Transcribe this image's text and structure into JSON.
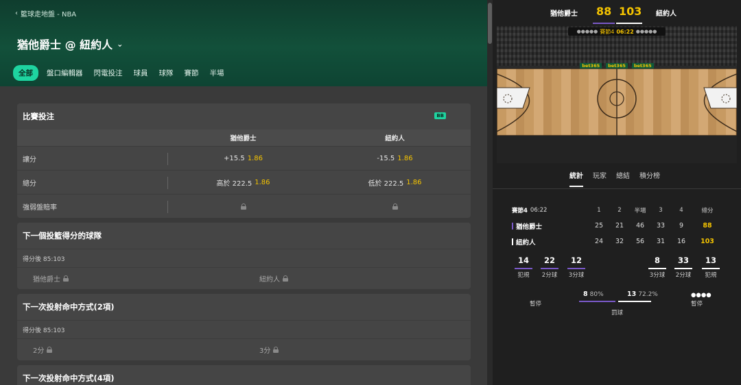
{
  "breadcrumb": {
    "back_icon": "chevron-left-icon",
    "text": "籃球走地盤 - NBA"
  },
  "match": {
    "title": "猶他爵士 @ 紐約人"
  },
  "tabs": [
    "全部",
    "盤口編輯器",
    "閃電投注",
    "球員",
    "球隊",
    "賽節",
    "半場"
  ],
  "markets": {
    "game_bet": {
      "title": "比賽投注",
      "badge": "BB",
      "columns": [
        "猶他爵士",
        "紐約人"
      ],
      "rows": [
        {
          "label": "讓分",
          "home": {
            "line": "+15.5",
            "odds": "1.86"
          },
          "away": {
            "line": "-15.5",
            "odds": "1.86"
          }
        },
        {
          "label": "總分",
          "home": {
            "line": "高於 222.5",
            "odds": "1.86"
          },
          "away": {
            "line": "低於 222.5",
            "odds": "1.86"
          }
        },
        {
          "label": "強弱盤賠率",
          "home": {
            "line": "",
            "odds": ""
          },
          "away": {
            "line": "",
            "odds": ""
          }
        }
      ]
    },
    "next_team": {
      "title": "下一個投籃得分的球隊",
      "note": "得分後 85:103",
      "options": [
        "猶他爵士",
        "紐約人"
      ]
    },
    "next_method2": {
      "title": "下一次投射命中方式(2項)",
      "note": "得分後 85:103",
      "options": [
        "2分",
        "3分"
      ]
    },
    "next_method4": {
      "title": "下一次投射命中方式(4項)"
    }
  },
  "scoreboard": {
    "home": "猶他爵士",
    "away": "紐約人",
    "home_score": "88",
    "away_score": "103",
    "period": "賽節4",
    "clock": "06:22",
    "ads": [
      "bet365",
      "bet365",
      "bet365"
    ],
    "home_color": "#7a59c9",
    "away_color": "#ffffff"
  },
  "stat_tabs": [
    "統計",
    "玩家",
    "總結",
    "積分榜"
  ],
  "quarters": {
    "period_label": "賽節4",
    "clock": "06:22",
    "headers": [
      "1",
      "2",
      "半場",
      "3",
      "4",
      "總分"
    ],
    "rows": [
      {
        "team": "猶他爵士",
        "values": [
          "25",
          "21",
          "46",
          "33",
          "9"
        ],
        "total": "88"
      },
      {
        "team": "紐約人",
        "values": [
          "24",
          "32",
          "56",
          "31",
          "16"
        ],
        "total": "103"
      }
    ]
  },
  "team_stats": {
    "home": [
      {
        "value": "14",
        "label": "犯規"
      },
      {
        "value": "22",
        "label": "2分球"
      },
      {
        "value": "12",
        "label": "3分球"
      }
    ],
    "away": [
      {
        "value": "8",
        "label": "3分球"
      },
      {
        "value": "33",
        "label": "2分球"
      },
      {
        "value": "13",
        "label": "犯規"
      }
    ]
  },
  "free_throws": {
    "timeouts_label": "暫停",
    "home_made": "8",
    "home_pct": "80%",
    "away_made": "13",
    "away_pct": "72.2%",
    "label": "罰球",
    "away_timeouts_label": "暫停",
    "home_fraction": 0.8,
    "away_fraction": 0.722
  }
}
